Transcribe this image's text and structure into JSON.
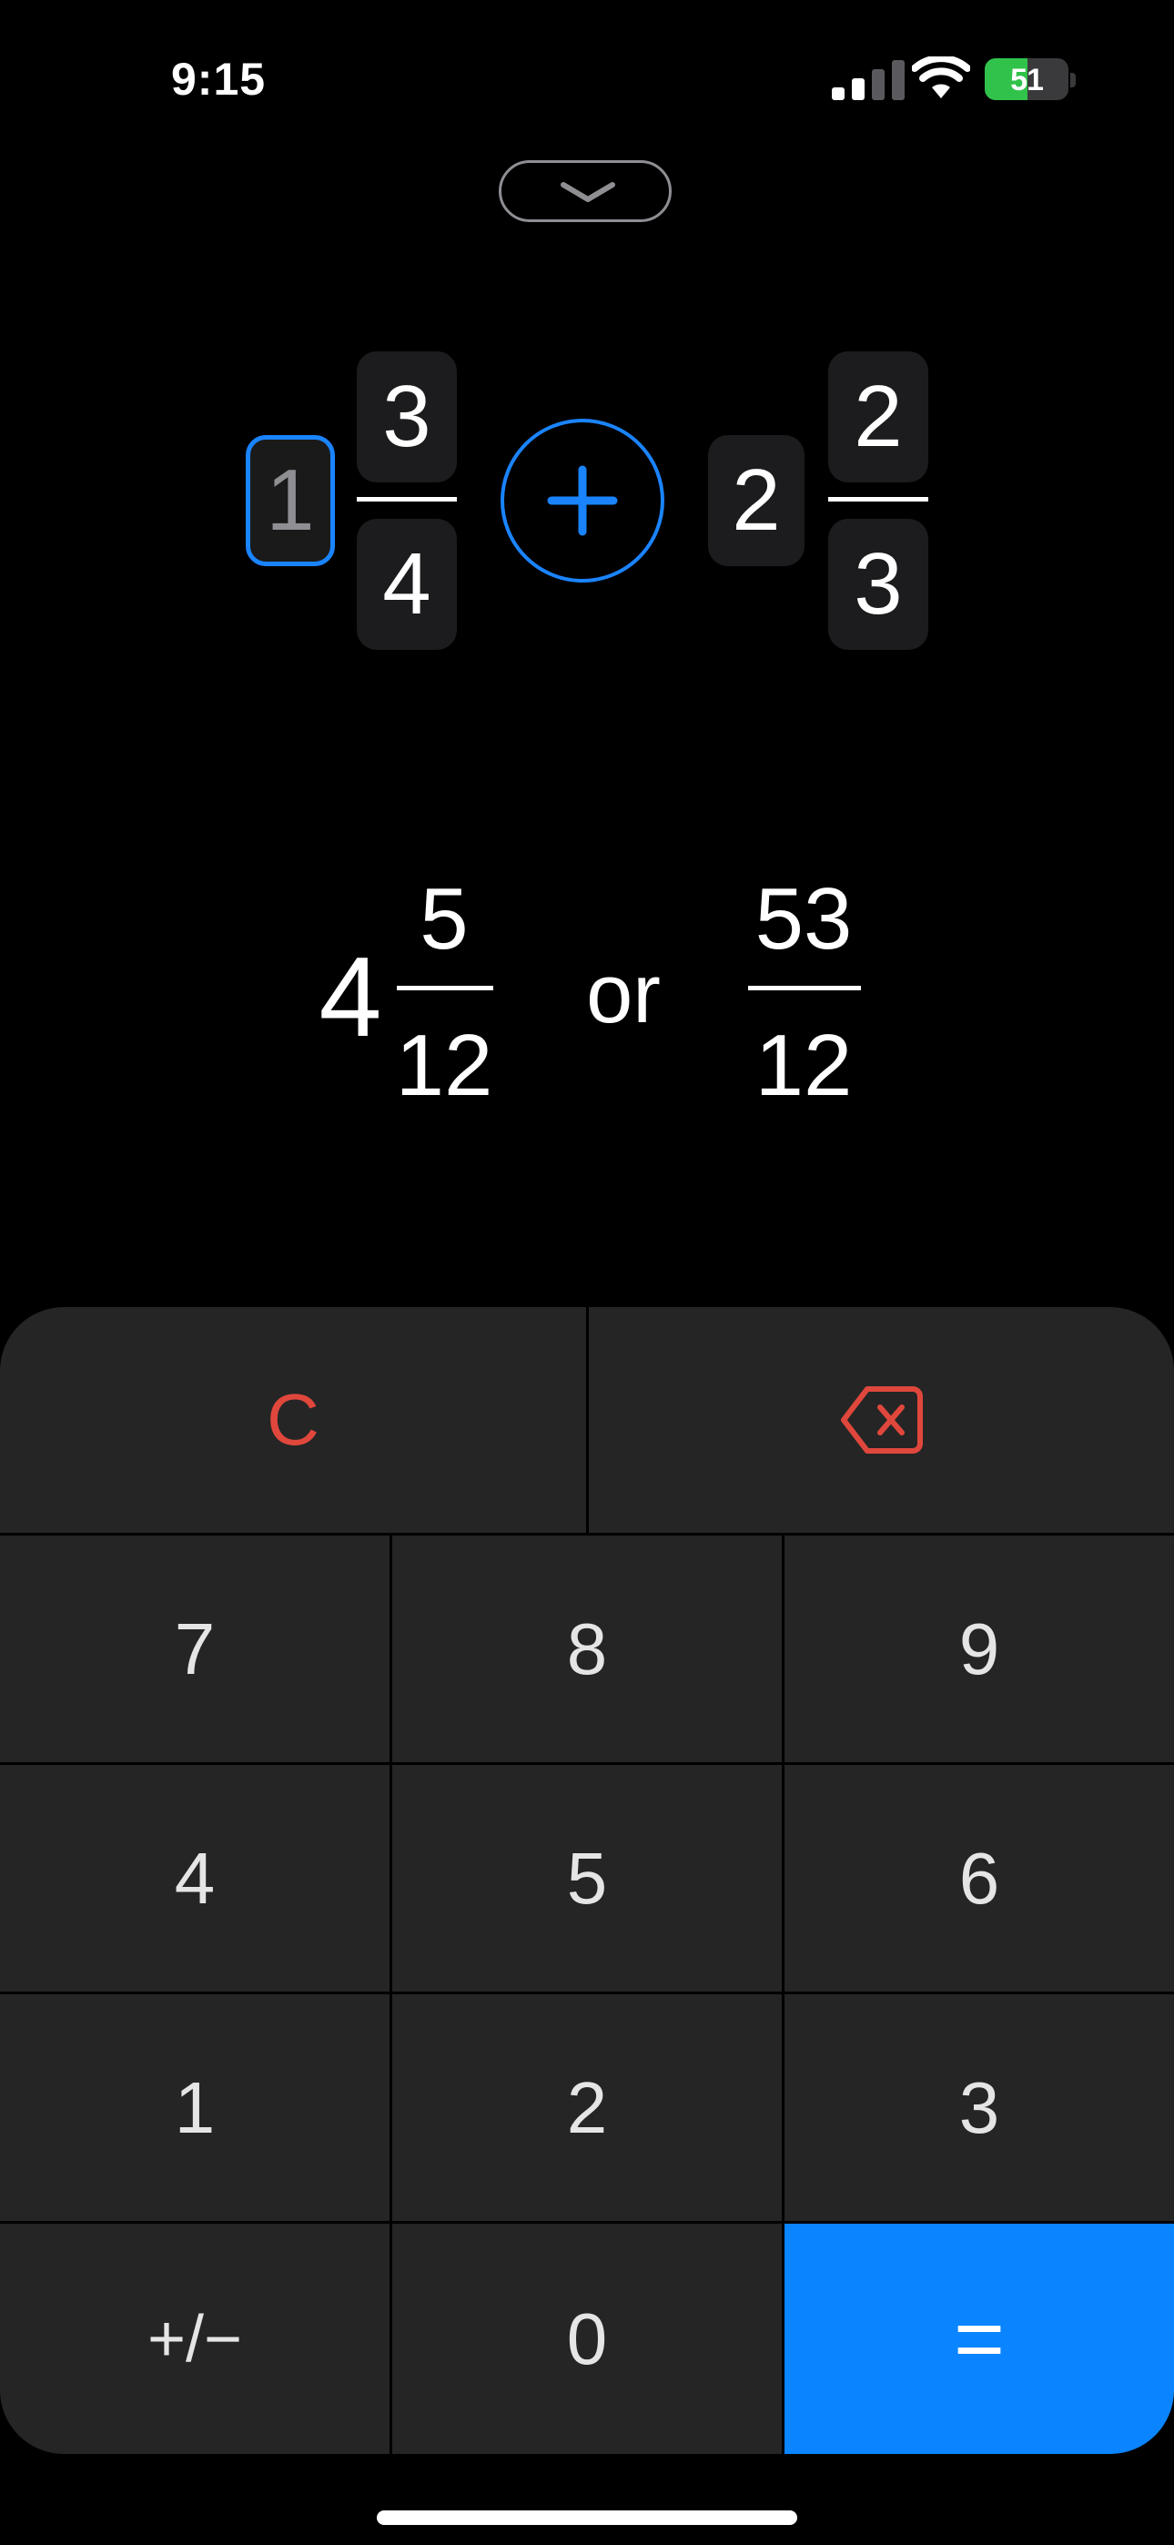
{
  "status_bar": {
    "time": "9:15",
    "battery_level": "51",
    "battery_fraction": 0.51,
    "icons": [
      "signal-icon",
      "wifi-icon",
      "battery-charging-icon"
    ]
  },
  "collapse": {
    "icon": "chevron-down-icon"
  },
  "input": {
    "first": {
      "whole": "1",
      "numerator": "3",
      "denominator": "4"
    },
    "operator": {
      "icon": "plus-icon",
      "symbol": "+"
    },
    "second": {
      "whole": "2",
      "numerator": "2",
      "denominator": "3"
    }
  },
  "result": {
    "mixed": {
      "whole": "4",
      "numerator": "5",
      "denominator": "12"
    },
    "connector": "or",
    "improper": {
      "numerator": "53",
      "denominator": "12"
    }
  },
  "keypad": {
    "clear": "C",
    "backspace_icon": "delete-left-icon",
    "digits": [
      "7",
      "8",
      "9",
      "4",
      "5",
      "6",
      "1",
      "2",
      "3"
    ],
    "sign": "+/−",
    "zero": "0",
    "equals": "="
  },
  "colors": {
    "accent": "#0a84ff",
    "clear": "#e0473c",
    "key_bg": "#252525",
    "background": "#000000"
  }
}
